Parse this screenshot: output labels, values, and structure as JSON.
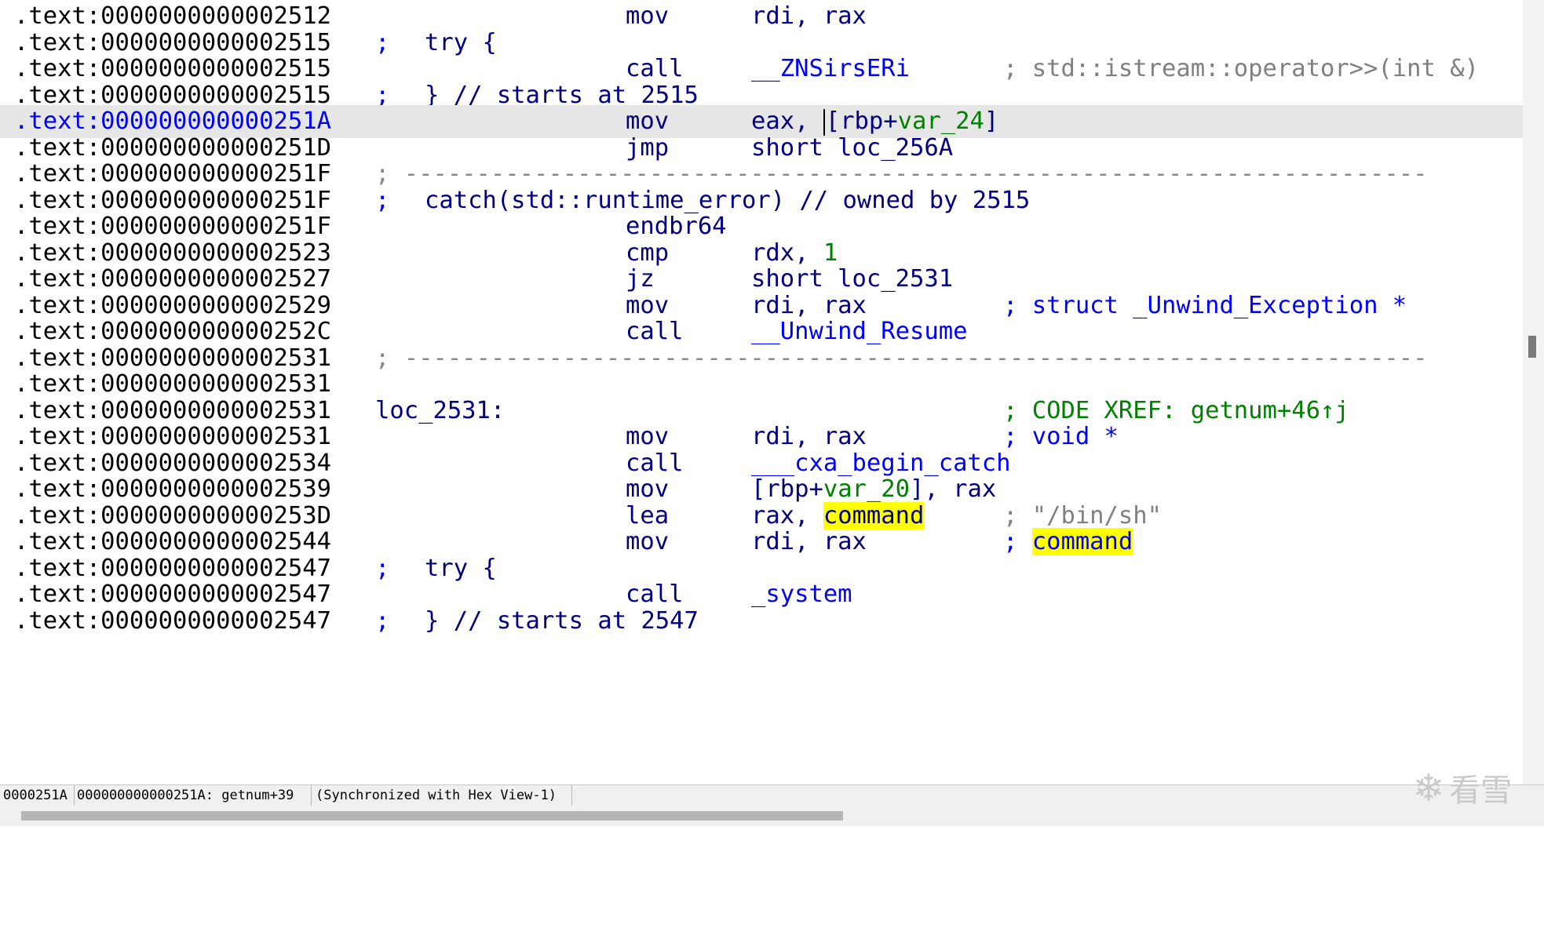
{
  "lines": [
    {
      "addr": ".text:0000000000002512",
      "mnem": "mov",
      "ops": "rdi, rax"
    },
    {
      "addr": ".text:0000000000002515",
      "cmt": ";",
      "kw": "try {"
    },
    {
      "addr": ".text:0000000000002515",
      "mnem": "call",
      "ops": "__ZNSirsERi",
      "rcmt": "; std::istream::operator>>(int &)"
    },
    {
      "addr": ".text:0000000000002515",
      "cmt": ";",
      "kw": "} // starts at 2515"
    },
    {
      "addr": ".text:000000000000251A",
      "mnem": "mov",
      "ops_a": "eax, ",
      "ops_b": "[rbp+",
      "ops_c": "var_24",
      "ops_d": "]"
    },
    {
      "addr": ".text:000000000000251D",
      "mnem": "jmp",
      "ops": "short loc_256A"
    },
    {
      "addr": ".text:000000000000251F",
      "sep": "; -----------------------------------------------------------------------"
    },
    {
      "addr": ".text:000000000000251F",
      "cmt": ";",
      "kw": "catch(std::runtime_error) // owned by 2515"
    },
    {
      "addr": ".text:000000000000251F",
      "mnem": "endbr64"
    },
    {
      "addr": ".text:0000000000002523",
      "mnem": "cmp",
      "ops_a": "rdx, ",
      "ops_n": "1"
    },
    {
      "addr": ".text:0000000000002527",
      "mnem": "jz",
      "ops": "short loc_2531"
    },
    {
      "addr": ".text:0000000000002529",
      "mnem": "mov",
      "ops": "rdi, rax",
      "rcmt": "; struct _Unwind_Exception *"
    },
    {
      "addr": ".text:000000000000252C",
      "mnem": "call",
      "ops": "__Unwind_Resume"
    },
    {
      "addr": ".text:0000000000002531",
      "sep": "; -----------------------------------------------------------------------"
    },
    {
      "addr": ".text:0000000000002531"
    },
    {
      "addr": ".text:0000000000002531",
      "label": "loc_2531:",
      "xref": "; CODE XREF: getnum+46↑j"
    },
    {
      "addr": ".text:0000000000002531",
      "mnem": "mov",
      "ops": "rdi, rax",
      "rcmt": "; void *"
    },
    {
      "addr": ".text:0000000000002534",
      "mnem": "call",
      "ops": "___cxa_begin_catch"
    },
    {
      "addr": ".text:0000000000002539",
      "mnem": "mov",
      "ops_a": "[rbp+",
      "ops_c": "var_20",
      "ops_d": "], rax"
    },
    {
      "addr": ".text:000000000000253D",
      "mnem": "lea",
      "ops_a": "rax, ",
      "ops_hl": "command",
      "rcmt": "; \"/bin/sh\""
    },
    {
      "addr": ".text:0000000000002544",
      "mnem": "mov",
      "ops": "rdi, rax",
      "rcmt_a": "; ",
      "rcmt_hl": "command"
    },
    {
      "addr": ".text:0000000000002547",
      "cmt": ";",
      "kw": "try {"
    },
    {
      "addr": ".text:0000000000002547",
      "mnem": "call",
      "ops": "_system"
    },
    {
      "addr": ".text:0000000000002547",
      "cmt": ";",
      "kw": "} // starts at 2547"
    }
  ],
  "status": {
    "offset": "0000251A",
    "location": "000000000000251A: getnum+39",
    "sync": "(Synchronized with Hex View-1)"
  },
  "watermark": {
    "icon": "snowflake-icon",
    "text": "看雪"
  }
}
